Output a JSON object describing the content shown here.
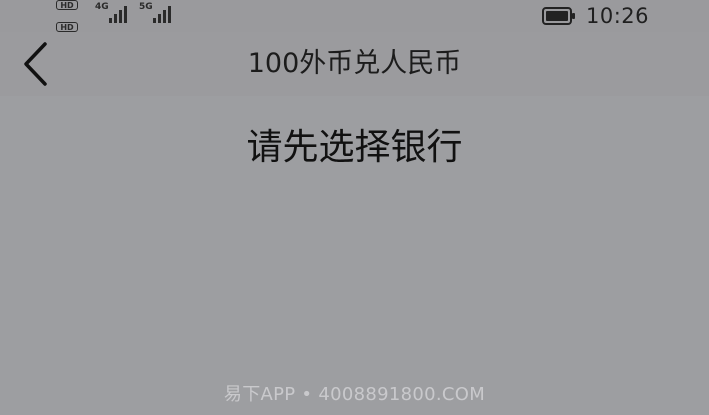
{
  "status_bar": {
    "hd_badge_1": "HD",
    "hd_badge_2": "HD",
    "network_1": "4G",
    "network_2": "5G",
    "time": "10:26",
    "battery_icon": "battery-full-icon",
    "signal_icon": "signal-bars-icon"
  },
  "header": {
    "back_icon": "chevron-left-icon",
    "title": "100外币兑人民币"
  },
  "main": {
    "message": "请先选择银行"
  },
  "footer": {
    "watermark": "易下APP • 4008891800.COM"
  },
  "colors": {
    "background": "#9d9ea1",
    "text": "#1b1b1b",
    "watermark": "#c9c9cc"
  }
}
